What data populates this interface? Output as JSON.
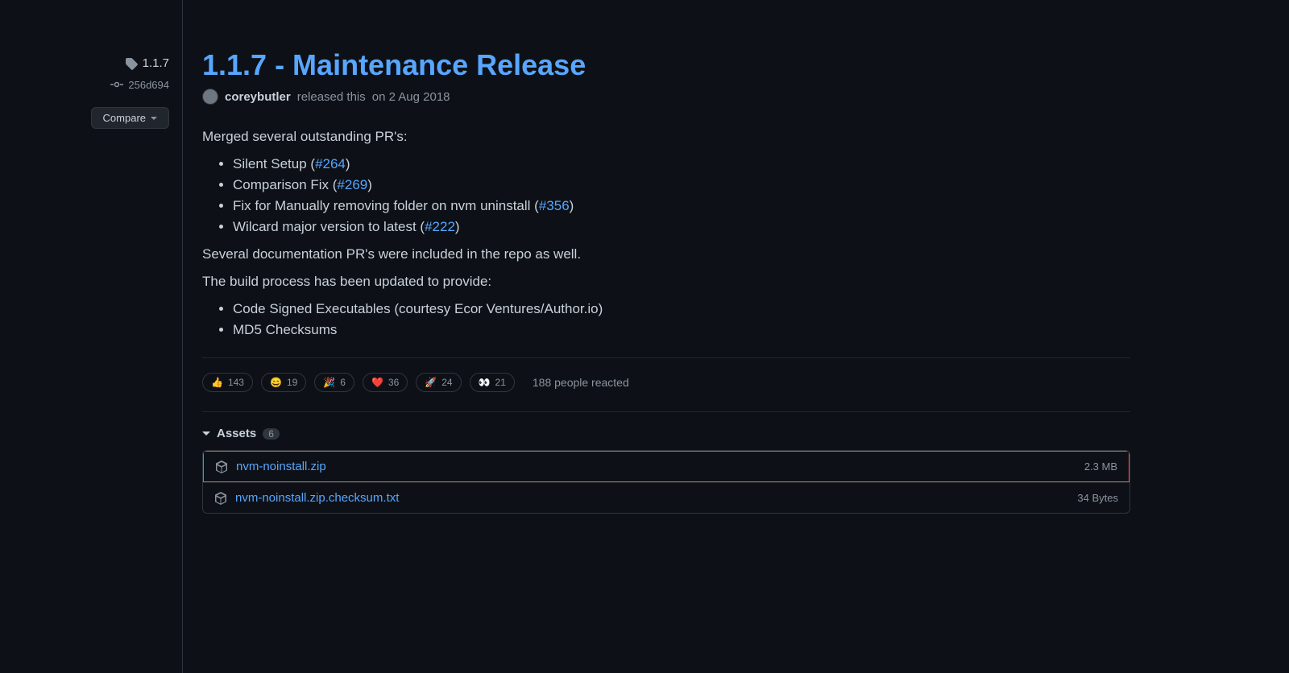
{
  "sidebar": {
    "tag": "1.1.7",
    "commit": "256d694",
    "compare_label": "Compare"
  },
  "release": {
    "title": "1.1.7 - Maintenance Release",
    "author": "coreybutler",
    "released_text": "released this",
    "date": "on 2 Aug 2018",
    "intro": "Merged several outstanding PR's:",
    "prs": [
      {
        "text": "Silent Setup (",
        "link": "#264",
        "close": ")"
      },
      {
        "text": "Comparison Fix (",
        "link": "#269",
        "close": ")"
      },
      {
        "text": "Fix for Manually removing folder on nvm uninstall (",
        "link": "#356",
        "close": ")"
      },
      {
        "text": "Wilcard major version to latest (",
        "link": "#222",
        "close": ")"
      }
    ],
    "doc_note": "Several documentation PR's were included in the repo as well.",
    "build_note": "The build process has been updated to provide:",
    "build_items": [
      "Code Signed Executables (courtesy Ecor Ventures/Author.io)",
      "MD5 Checksums"
    ]
  },
  "reactions": {
    "items": [
      {
        "emoji": "👍",
        "count": "143"
      },
      {
        "emoji": "😄",
        "count": "19"
      },
      {
        "emoji": "🎉",
        "count": "6"
      },
      {
        "emoji": "❤️",
        "count": "36"
      },
      {
        "emoji": "🚀",
        "count": "24"
      },
      {
        "emoji": "👀",
        "count": "21"
      }
    ],
    "summary": "188 people reacted"
  },
  "assets": {
    "label": "Assets",
    "count": "6",
    "items": [
      {
        "name": "nvm-noinstall.zip",
        "size": "2.3 MB",
        "highlight": true
      },
      {
        "name": "nvm-noinstall.zip.checksum.txt",
        "size": "34 Bytes",
        "highlight": false
      }
    ]
  }
}
